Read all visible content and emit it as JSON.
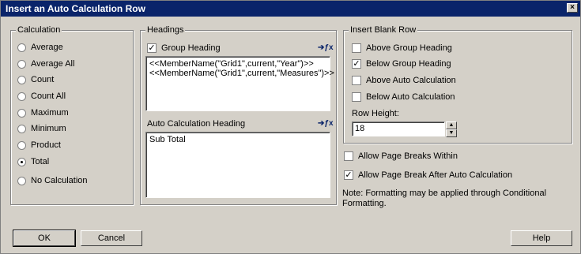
{
  "window": {
    "title": "Insert an Auto Calculation Row",
    "close": "×"
  },
  "calculation": {
    "legend": "Calculation",
    "options": [
      {
        "label": "Average",
        "selected": false
      },
      {
        "label": "Average All",
        "selected": false
      },
      {
        "label": "Count",
        "selected": false
      },
      {
        "label": "Count All",
        "selected": false
      },
      {
        "label": "Maximum",
        "selected": false
      },
      {
        "label": "Minimum",
        "selected": false
      },
      {
        "label": "Product",
        "selected": false
      },
      {
        "label": "Total",
        "selected": true
      },
      {
        "label": "No Calculation",
        "selected": false
      }
    ]
  },
  "headings": {
    "legend": "Headings",
    "group_heading_label": "Group Heading",
    "group_heading_checked": true,
    "group_heading_text": "<<MemberName(\"Grid1\",current,\"Year\")>>\n<<MemberName(\"Grid1\",current,\"Measures\")>>",
    "auto_calc_heading_label": "Auto Calculation Heading",
    "auto_calc_heading_text": "Sub Total"
  },
  "insert_blank_row": {
    "legend": "Insert Blank Row",
    "above_group": {
      "label": "Above Group Heading",
      "checked": false
    },
    "below_group": {
      "label": "Below Group Heading",
      "checked": true
    },
    "above_auto": {
      "label": "Above Auto Calculation",
      "checked": false
    },
    "below_auto": {
      "label": "Below Auto Calculation",
      "checked": false
    },
    "row_height_label": "Row Height:",
    "row_height_value": "18"
  },
  "page_breaks": {
    "within": {
      "label": "Allow Page Breaks Within",
      "checked": false
    },
    "after": {
      "label": "Allow Page Break After Auto Calculation",
      "checked": true
    }
  },
  "note": "Note: Formatting may be applied through Conditional Formatting.",
  "buttons": {
    "ok": "OK",
    "cancel": "Cancel",
    "help": "Help"
  }
}
